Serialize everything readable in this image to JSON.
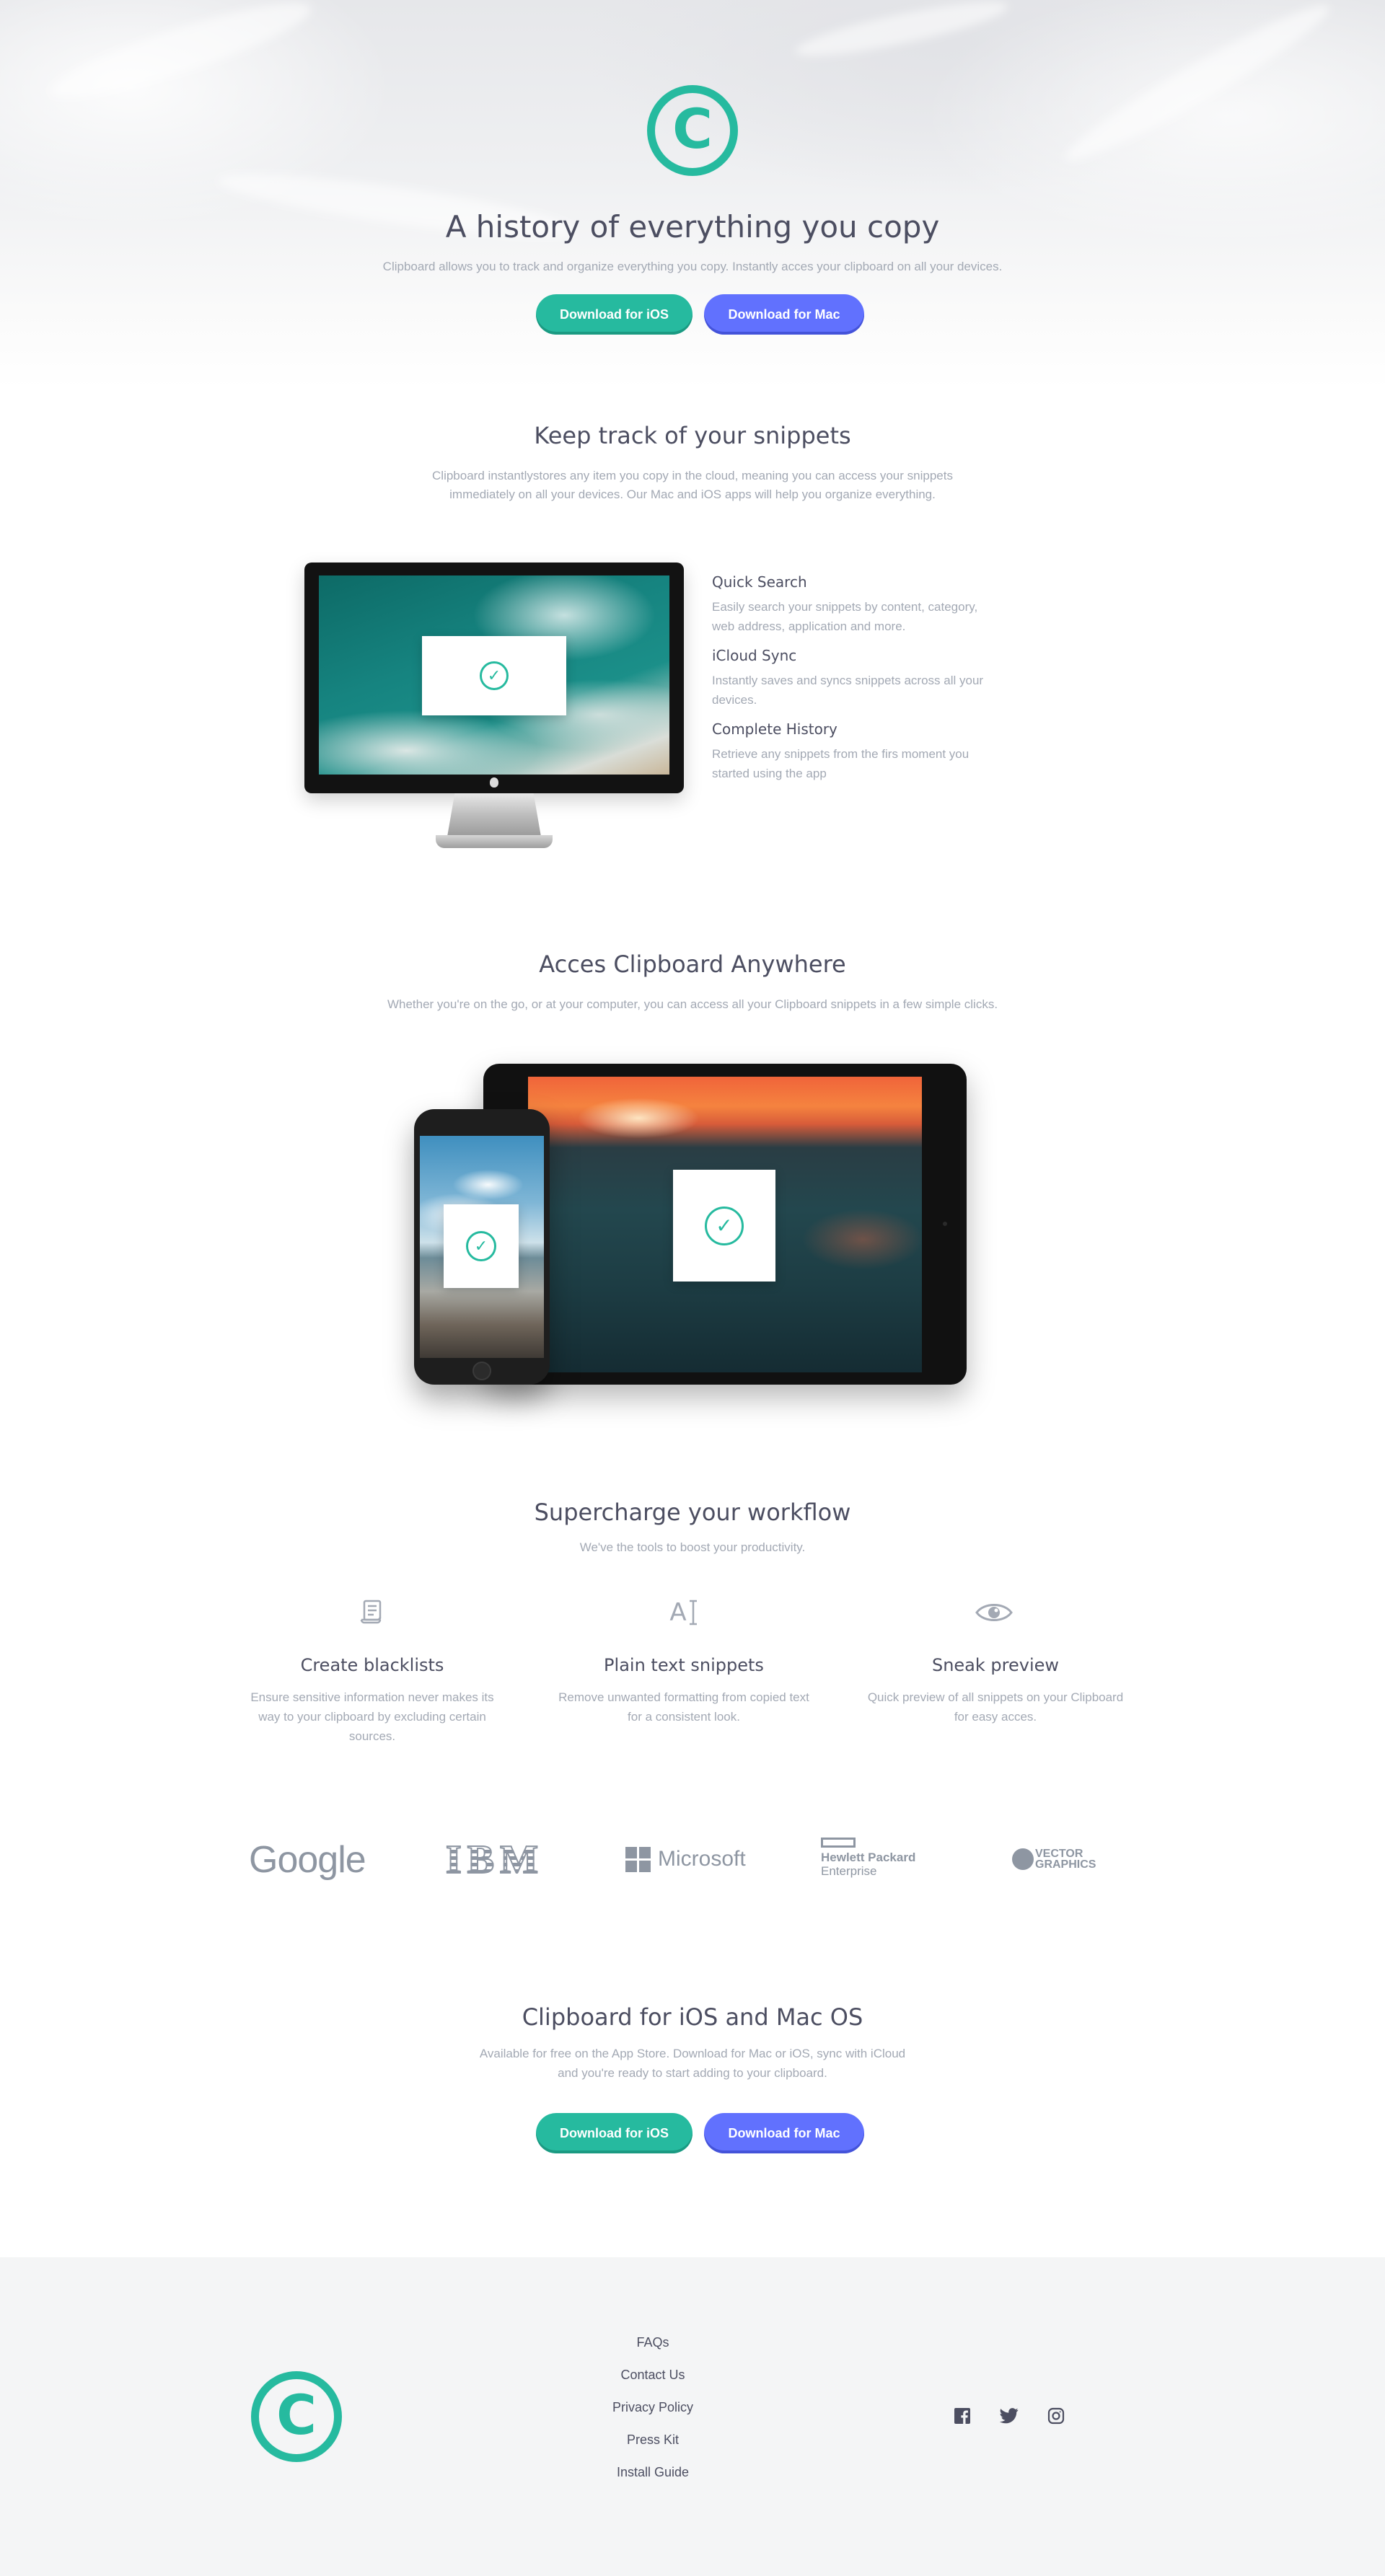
{
  "colors": {
    "accent_green": "#26ba9f",
    "accent_blue": "#6171fe",
    "heading": "#4c4e61",
    "body_text": "#a3a9b4",
    "footer_bg": "#f4f5f6"
  },
  "hero": {
    "logo_icon": "copyright-icon",
    "title": "A history of everything you copy",
    "subtitle": "Clipboard allows you to track and organize everything you copy. Instantly acces your clipboard on all your devices.",
    "ios_button": "Download for iOS",
    "mac_button": "Download for Mac"
  },
  "snippets": {
    "title": "Keep track of your snippets",
    "subtitle_line1": "Clipboard instantlystores any item you copy in the cloud, meaning you can access your snippets",
    "subtitle_line2": "immediately on all your devices. Our Mac and iOS apps will help you organize everything.",
    "features": [
      {
        "title": "Quick Search",
        "line1": "Easily search your snippets by content, category,",
        "line2": "web address, application and more."
      },
      {
        "title": "iCloud Sync",
        "line1": "Instantly saves and syncs snippets across all your",
        "line2": "devices."
      },
      {
        "title": "Complete History",
        "line1": "Retrieve any snippets from the firs moment you",
        "line2": "started using the app"
      }
    ]
  },
  "access": {
    "title": "Acces Clipboard Anywhere",
    "subtitle": "Whether you're on the go, or at your computer, you can access all your Clipboard snippets in a few simple clicks."
  },
  "workflow": {
    "title": "Supercharge your workflow",
    "subtitle": "We've the tools to boost your productivity.",
    "tools": [
      {
        "icon": "blacklist-scroll-icon",
        "title": "Create blacklists",
        "line1": "Ensure sensitive information never makes its",
        "line2": "way to your clipboard by excluding certain",
        "line3": "sources."
      },
      {
        "icon": "text-cursor-icon",
        "glyph": "A",
        "title": "Plain text snippets",
        "line1": "Remove unwanted formatting from copied text",
        "line2": "for a consistent look."
      },
      {
        "icon": "eye-icon",
        "title": "Sneak preview",
        "line1": "Quick preview of all snippets on your Clipboard",
        "line2": "for easy acces."
      }
    ]
  },
  "partners": {
    "google": "Google",
    "ibm": "IBM",
    "microsoft": "Microsoft",
    "hp_line1": "Hewlett Packard",
    "hp_line2": "Enterprise",
    "vector_line1": "VECTOR",
    "vector_line2": "GRAPHICS"
  },
  "cta": {
    "title": "Clipboard for iOS and Mac OS",
    "subtitle_line1": "Available for free on the App Store. Download for Mac or iOS, sync with iCloud",
    "subtitle_line2": "and you're ready to start adding to your clipboard.",
    "ios_button": "Download for iOS",
    "mac_button": "Download for Mac"
  },
  "footer": {
    "links": [
      "FAQs",
      "Contact Us",
      "Privacy Policy",
      "Press Kit",
      "Install Guide"
    ],
    "socials": [
      "facebook-icon",
      "twitter-icon",
      "instagram-icon"
    ]
  }
}
